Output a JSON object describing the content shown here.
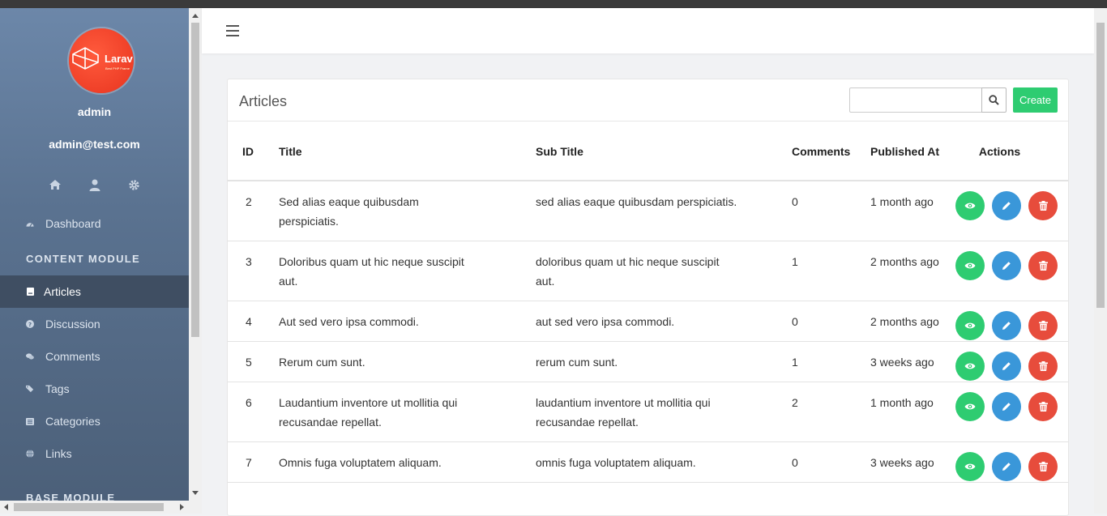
{
  "user": {
    "name": "admin",
    "email": "admin@test.com",
    "logo_text": "Larav",
    "logo_subtext": "Best PHP Frame"
  },
  "sidebar": {
    "dashboard_label": "Dashboard",
    "content_header": "CONTENT MODULE",
    "items": [
      {
        "label": "Articles",
        "icon": "book-icon"
      },
      {
        "label": "Discussion",
        "icon": "question-circle-icon"
      },
      {
        "label": "Comments",
        "icon": "comments-icon"
      },
      {
        "label": "Tags",
        "icon": "tags-icon"
      },
      {
        "label": "Categories",
        "icon": "list-icon"
      },
      {
        "label": "Links",
        "icon": "globe-icon"
      }
    ],
    "base_header": "BASE MODULE"
  },
  "page": {
    "title": "Articles",
    "search_placeholder": "",
    "create_label": "Create"
  },
  "table": {
    "headers": {
      "id": "ID",
      "title": "Title",
      "subtitle": "Sub Title",
      "comments": "Comments",
      "published": "Published At",
      "actions": "Actions"
    },
    "rows": [
      {
        "id": "2",
        "title": "Sed alias eaque quibusdam perspiciatis.",
        "subtitle": "sed alias eaque quibusdam perspiciatis.",
        "comments": "0",
        "published": "1 month ago"
      },
      {
        "id": "3",
        "title": "Doloribus quam ut hic neque suscipit aut.",
        "subtitle": "doloribus quam ut hic neque suscipit aut.",
        "comments": "1",
        "published": "2 months ago"
      },
      {
        "id": "4",
        "title": "Aut sed vero ipsa commodi.",
        "subtitle": "aut sed vero ipsa commodi.",
        "comments": "0",
        "published": "2 months ago"
      },
      {
        "id": "5",
        "title": "Rerum cum sunt.",
        "subtitle": "rerum cum sunt.",
        "comments": "1",
        "published": "3 weeks ago"
      },
      {
        "id": "6",
        "title": "Laudantium inventore ut mollitia qui recusandae repellat.",
        "subtitle": "laudantium inventore ut mollitia qui recusandae repellat.",
        "comments": "2",
        "published": "1 month ago"
      },
      {
        "id": "7",
        "title": "Omnis fuga voluptatem aliquam.",
        "subtitle": "omnis fuga voluptatem aliquam.",
        "comments": "0",
        "published": "3 weeks ago"
      }
    ]
  },
  "colors": {
    "view": "#2ecc71",
    "edit": "#3a97d9",
    "delete": "#e74c3c",
    "create": "#2ecc71"
  }
}
